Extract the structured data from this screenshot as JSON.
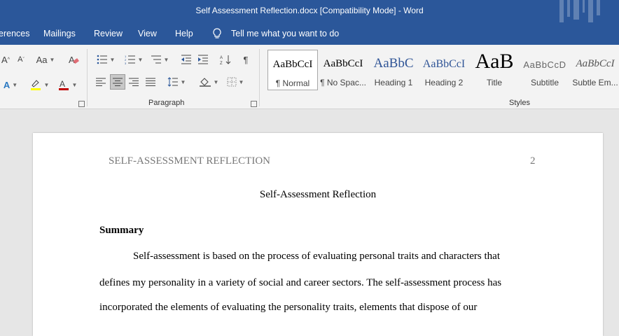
{
  "window": {
    "title": "Self Assessment Reflection.docx [Compatibility Mode]  -  Word"
  },
  "menu": {
    "references": "erences",
    "mailings": "Mailings",
    "review": "Review",
    "view": "View",
    "help": "Help",
    "tell_me": "Tell me what you want to do"
  },
  "ribbon": {
    "paragraph_label": "Paragraph",
    "styles_label": "Styles",
    "font_case": "Aa",
    "styles": [
      {
        "sample": "AaBbCcI",
        "name": "¶ Normal"
      },
      {
        "sample": "AaBbCcI",
        "name": "¶ No Spac..."
      },
      {
        "sample": "AaBbC",
        "name": "Heading 1"
      },
      {
        "sample": "AaBbCcI",
        "name": "Heading 2"
      },
      {
        "sample": "AaB",
        "name": "Title"
      },
      {
        "sample": "AaBbCcD",
        "name": "Subtitle"
      },
      {
        "sample": "AaBbCcI",
        "name": "Subtle Em..."
      }
    ]
  },
  "document": {
    "running_head": "SELF-ASSESSMENT REFLECTION",
    "page_number": "2",
    "title": "Self-Assessment Reflection",
    "heading": "Summary",
    "lines": [
      "Self-assessment is based on the process of evaluating personal traits and characters that",
      "defines my personality in a variety of social and career sectors. The self-assessment process has",
      "incorporated the elements of evaluating the personality traits, elements that dispose of our"
    ]
  },
  "colors": {
    "accent": "#2b579a",
    "font_color_bar": "#c00000",
    "highlight_bar": "#ffff00"
  }
}
